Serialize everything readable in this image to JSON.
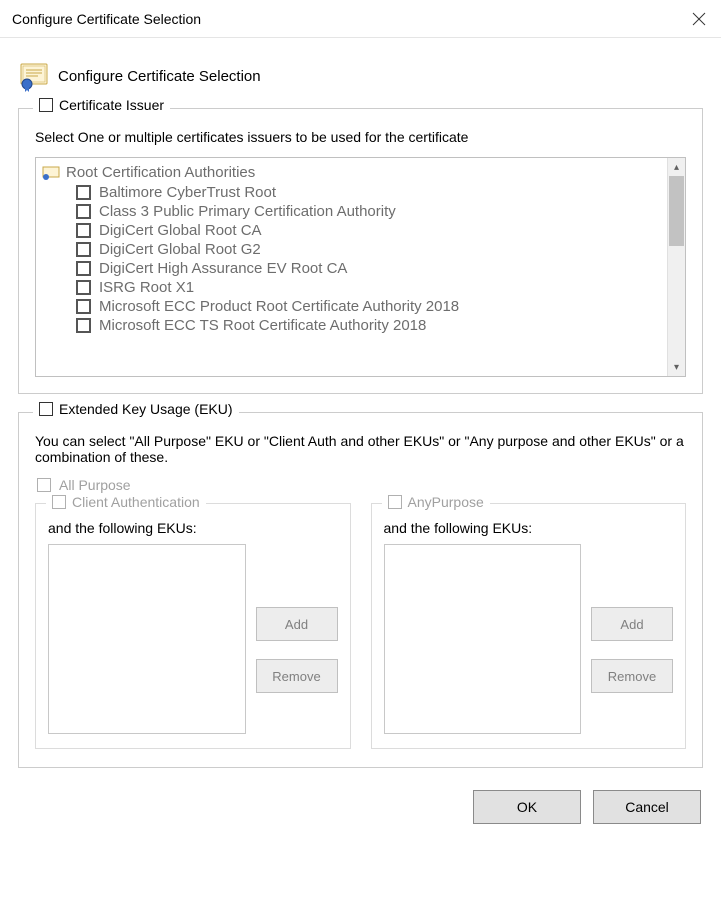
{
  "window": {
    "title": "Configure Certificate Selection"
  },
  "header": {
    "heading": "Configure Certificate Selection"
  },
  "issuer_group": {
    "legend": "Certificate Issuer",
    "description": "Select One or multiple certificates issuers to be used for the certificate",
    "root_label": "Root Certification Authorities",
    "items": [
      "Baltimore CyberTrust Root",
      "Class 3 Public Primary Certification Authority",
      "DigiCert Global Root CA",
      "DigiCert Global Root G2",
      "DigiCert High Assurance EV Root CA",
      "ISRG Root X1",
      "Microsoft ECC Product Root Certificate Authority 2018",
      "Microsoft ECC TS Root Certificate Authority 2018"
    ]
  },
  "eku_group": {
    "legend": "Extended Key Usage (EKU)",
    "description": "You can select \"All Purpose\" EKU or \"Client Auth and other EKUs\" or \"Any purpose and other EKUs\" or a combination of these.",
    "all_purpose_label": "All Purpose",
    "client_auth": {
      "legend": "Client Authentication",
      "following_label": "and the following EKUs:",
      "add_label": "Add",
      "remove_label": "Remove"
    },
    "any_purpose": {
      "legend": "AnyPurpose",
      "following_label": "and the following EKUs:",
      "add_label": "Add",
      "remove_label": "Remove"
    }
  },
  "dialog_buttons": {
    "ok": "OK",
    "cancel": "Cancel"
  }
}
